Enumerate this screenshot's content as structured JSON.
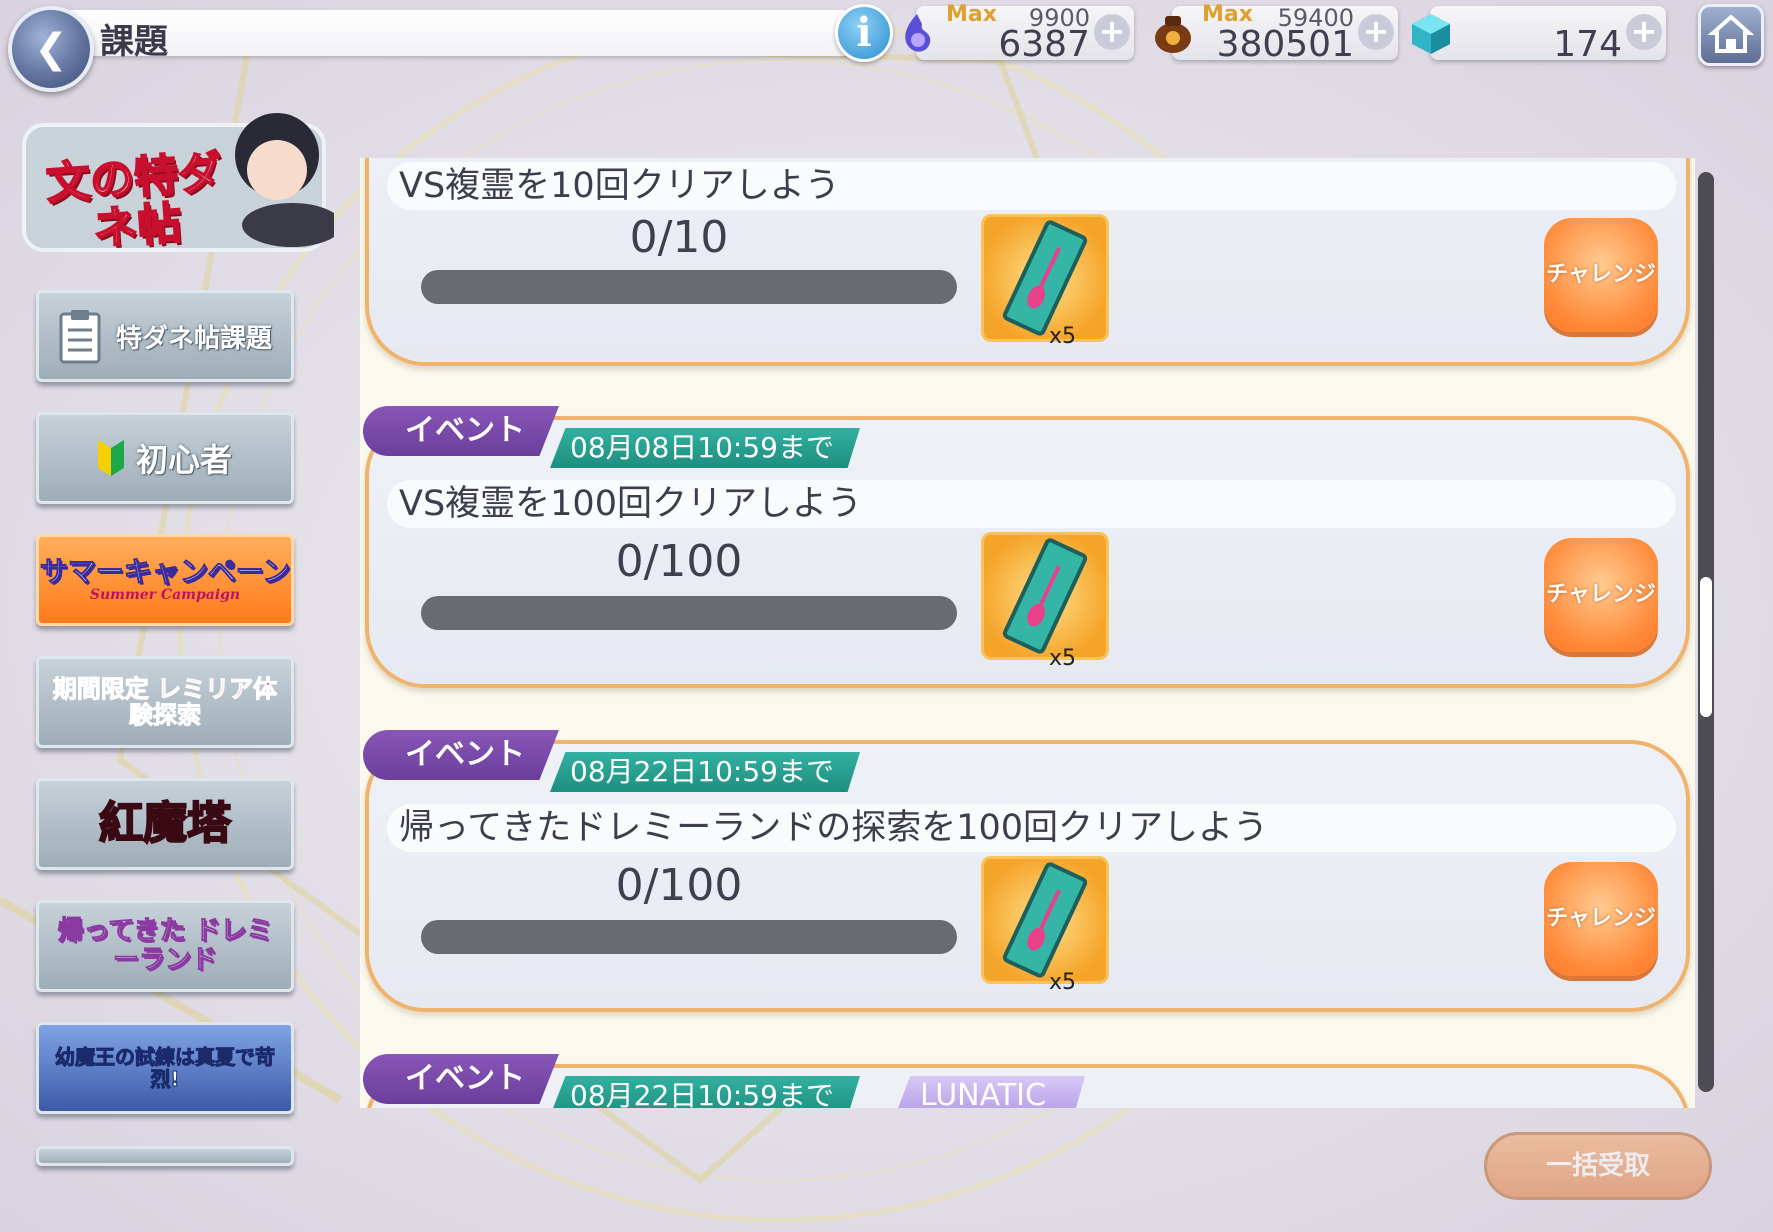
{
  "header": {
    "title": "課題",
    "info_label": "i",
    "back_icon": "back-arrow-icon",
    "home_icon": "home-icon"
  },
  "resources": [
    {
      "icon": "spirit-flame-icon",
      "max_label": "Max",
      "max_value": "9900",
      "value": "6387",
      "plus": "+"
    },
    {
      "icon": "bag-coin-icon",
      "max_label": "Max",
      "max_value": "59400",
      "value": "380501",
      "plus": "+"
    },
    {
      "icon": "gem-cube-icon",
      "value": "174",
      "plus": "+"
    }
  ],
  "sidebar": {
    "logo_text": "文の特ダネ帖",
    "items": [
      {
        "label": "特ダネ帖課題",
        "icon": "clipboard-icon"
      },
      {
        "label": "初心者",
        "icon": "beginner-leaf-icon"
      },
      {
        "label": "サマーキャンペーン",
        "sub": "Summer Campaign",
        "active": true
      },
      {
        "label": "期間限定 レミリア体験探索"
      },
      {
        "label": "紅魔塔"
      },
      {
        "label": "帰ってきた ドレミーランド"
      },
      {
        "label": "幼魔王の試練は真夏で苛烈!"
      }
    ]
  },
  "missions": [
    {
      "title": "VS複霊を10回クリアしよう",
      "progress_text": "0/10",
      "progress": 0,
      "reward_qty": "x5",
      "button": "チャレンジ"
    },
    {
      "tag": "イベント",
      "deadline": "08月08日10:59まで",
      "title": "VS複霊を100回クリアしよう",
      "progress_text": "0/100",
      "progress": 0,
      "reward_qty": "x5",
      "button": "チャレンジ"
    },
    {
      "tag": "イベント",
      "deadline": "08月22日10:59まで",
      "title": "帰ってきたドレミーランドの探索を100回クリアしよう",
      "progress_text": "0/100",
      "progress": 0,
      "reward_qty": "x5",
      "button": "チャレンジ"
    },
    {
      "tag": "イベント",
      "deadline": "08月22日10:59まで",
      "difficulty": "LUNATIC"
    }
  ],
  "footer": {
    "bulk_receive": "一括受取"
  }
}
